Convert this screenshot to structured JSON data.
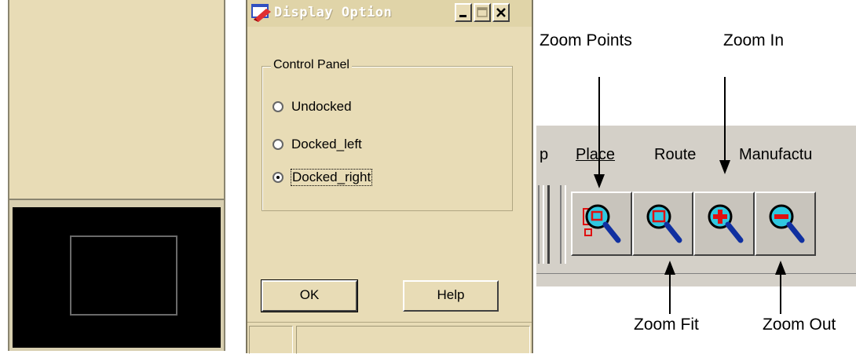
{
  "dialog": {
    "title": "Display Option",
    "icon": "app-window-icon",
    "group_label": "Control Panel",
    "options": [
      {
        "label": "Undocked",
        "checked": false
      },
      {
        "label": "Docked_left",
        "checked": false
      },
      {
        "label": "Docked_right",
        "checked": true
      }
    ],
    "ok_label": "OK",
    "help_label": "Help"
  },
  "menu": {
    "items": [
      "p",
      "Place",
      "Route",
      "Manufactu"
    ]
  },
  "toolbar": {
    "buttons": [
      {
        "name": "zoom-points-button",
        "icon": "zoom-points-icon"
      },
      {
        "name": "zoom-fit-button",
        "icon": "zoom-fit-icon"
      },
      {
        "name": "zoom-in-button",
        "icon": "zoom-in-icon"
      },
      {
        "name": "zoom-out-button",
        "icon": "zoom-out-icon"
      }
    ]
  },
  "callouts": {
    "zoom_points": "Zoom Points",
    "zoom_in": "Zoom In",
    "zoom_fit": "Zoom Fit",
    "zoom_out": "Zoom Out"
  },
  "colors": {
    "dialog_bg": "#e8dcb6",
    "toolbar_bg": "#d4d0c8",
    "view_bg": "#000000"
  }
}
